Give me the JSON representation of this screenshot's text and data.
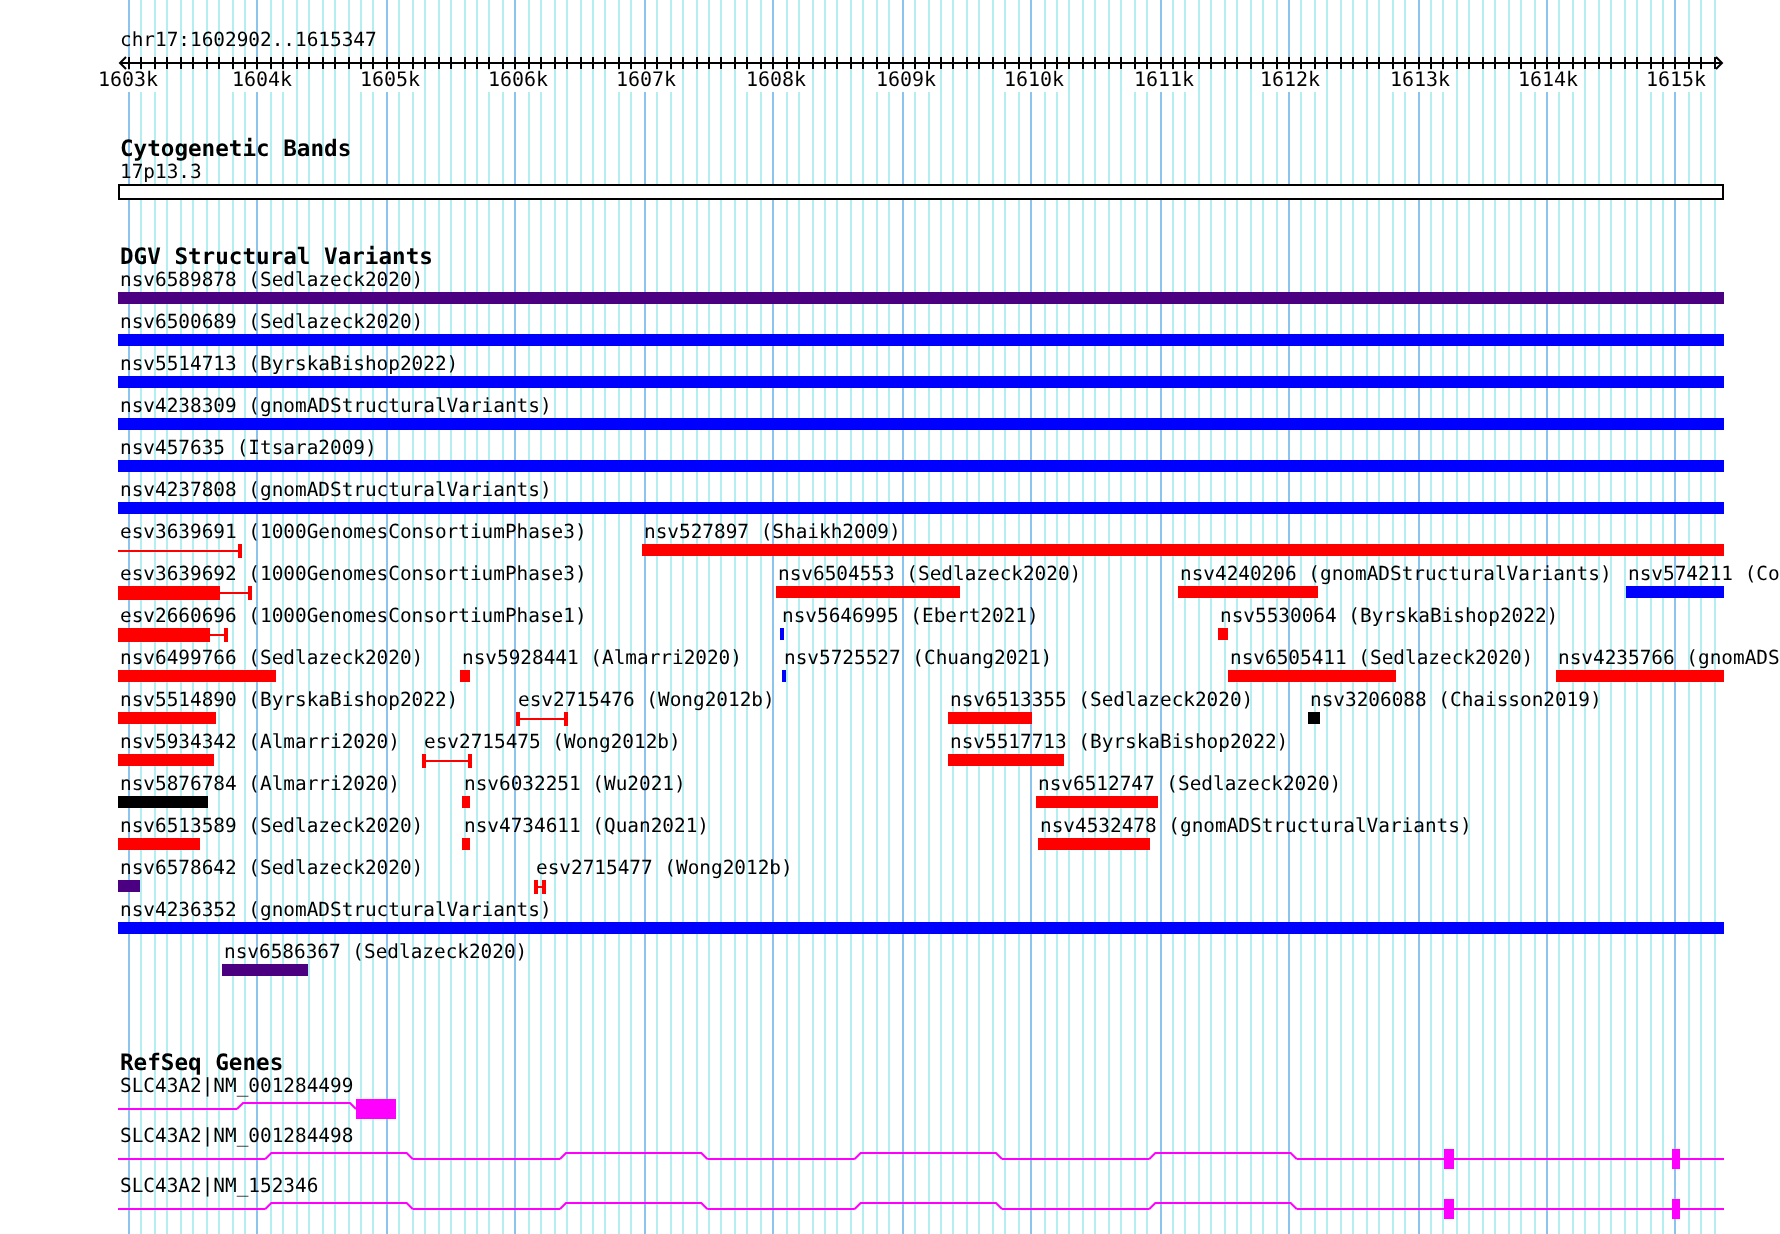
{
  "location": "chr17:1602902..1615347",
  "ruler": {
    "ticks": [
      "1603k",
      "1604k",
      "1605k",
      "1606k",
      "1607k",
      "1608k",
      "1609k",
      "1610k",
      "1611k",
      "1612k",
      "1613k",
      "1614k",
      "1615k"
    ]
  },
  "tracks": [
    {
      "kind": "bands",
      "title": "Cytogenetic Bands",
      "bands": [
        {
          "label": "17p13.3"
        }
      ]
    },
    {
      "kind": "variants",
      "title": "DGV Structural Variants",
      "rows": [
        {
          "features": [
            {
              "label": "nsv6589878 (Sedlazeck2020)",
              "kind": "bar",
              "color": "#4b0082"
            }
          ]
        },
        {
          "features": [
            {
              "label": "nsv6500689 (Sedlazeck2020)",
              "kind": "bar",
              "color": "#0000ff"
            }
          ]
        },
        {
          "features": [
            {
              "label": "nsv5514713 (ByrskaBishop2022)",
              "kind": "bar",
              "color": "#0000ff"
            }
          ]
        },
        {
          "features": [
            {
              "label": "nsv4238309 (gnomADStructuralVariants)",
              "kind": "bar",
              "color": "#0000ff"
            }
          ]
        },
        {
          "features": [
            {
              "label": "nsv457635 (Itsara2009)",
              "kind": "bar",
              "color": "#0000ff"
            }
          ]
        },
        {
          "features": [
            {
              "label": "nsv4237808 (gnomADStructuralVariants)",
              "kind": "bar",
              "color": "#0000ff"
            }
          ]
        },
        {
          "features": [
            {
              "label": "esv3639691 (1000GenomesConsortiumPhase3)",
              "kind": "interval",
              "color": "#ff0000"
            },
            {
              "label": "nsv527897 (Shaikh2009)",
              "kind": "bar",
              "color": "#ff0000"
            }
          ]
        },
        {
          "features": [
            {
              "label": "esv3639692 (1000GenomesConsortiumPhase3)",
              "kind": "interval",
              "color": "#ff0000"
            },
            {
              "label": "nsv6504553 (Sedlazeck2020)",
              "kind": "bar",
              "color": "#ff0000"
            },
            {
              "label": "nsv4240206 (gnomADStructuralVariants)",
              "kind": "bar",
              "color": "#ff0000"
            },
            {
              "label": "nsv574211 (Co",
              "kind": "bar",
              "color": "#0000ff"
            }
          ]
        },
        {
          "features": [
            {
              "label": "esv2660696 (1000GenomesConsortiumPhase1)",
              "kind": "interval",
              "color": "#ff0000"
            },
            {
              "label": "nsv5646995 (Ebert2021)",
              "kind": "bar",
              "color": "#0000ff"
            },
            {
              "label": "nsv5530064 (ByrskaBishop2022)",
              "kind": "bar",
              "color": "#ff0000"
            }
          ]
        },
        {
          "features": [
            {
              "label": "nsv6499766 (Sedlazeck2020)",
              "kind": "bar",
              "color": "#ff0000"
            },
            {
              "label": "nsv5928441 (Almarri2020)",
              "kind": "bar",
              "color": "#ff0000"
            },
            {
              "label": "nsv5725527 (Chuang2021)",
              "kind": "bar",
              "color": "#0000ff"
            },
            {
              "label": "nsv6505411 (Sedlazeck2020)",
              "kind": "bar",
              "color": "#ff0000"
            },
            {
              "label": "nsv4235766 (gnomADS",
              "kind": "bar",
              "color": "#ff0000"
            }
          ]
        },
        {
          "features": [
            {
              "label": "nsv5514890 (ByrskaBishop2022)",
              "kind": "bar",
              "color": "#ff0000"
            },
            {
              "label": "esv2715476 (Wong2012b)",
              "kind": "interval",
              "color": "#ff0000"
            },
            {
              "label": "nsv6513355 (Sedlazeck2020)",
              "kind": "bar",
              "color": "#ff0000"
            },
            {
              "label": "nsv3206088 (Chaisson2019)",
              "kind": "bar",
              "color": "#000000"
            }
          ]
        },
        {
          "features": [
            {
              "label": "nsv5934342 (Almarri2020)",
              "kind": "bar",
              "color": "#ff0000"
            },
            {
              "label": "esv2715475 (Wong2012b)",
              "kind": "interval",
              "color": "#ff0000"
            },
            {
              "label": "nsv5517713 (ByrskaBishop2022)",
              "kind": "bar",
              "color": "#ff0000"
            }
          ]
        },
        {
          "features": [
            {
              "label": "nsv5876784 (Almarri2020)",
              "kind": "bar",
              "color": "#000000"
            },
            {
              "label": "nsv6032251 (Wu2021)",
              "kind": "bar",
              "color": "#ff0000"
            },
            {
              "label": "nsv6512747 (Sedlazeck2020)",
              "kind": "bar",
              "color": "#ff0000"
            }
          ]
        },
        {
          "features": [
            {
              "label": "nsv6513589 (Sedlazeck2020)",
              "kind": "bar",
              "color": "#ff0000"
            },
            {
              "label": "nsv4734611 (Quan2021)",
              "kind": "bar",
              "color": "#ff0000"
            },
            {
              "label": "nsv4532478 (gnomADStructuralVariants)",
              "kind": "bar",
              "color": "#ff0000"
            }
          ]
        },
        {
          "features": [
            {
              "label": "nsv6578642 (Sedlazeck2020)",
              "kind": "bar",
              "color": "#4b0082"
            },
            {
              "label": "esv2715477 (Wong2012b)",
              "kind": "interval",
              "color": "#ff0000"
            }
          ]
        },
        {
          "features": [
            {
              "label": "nsv4236352 (gnomADStructuralVariants)",
              "kind": "bar",
              "color": "#0000ff"
            }
          ]
        },
        {
          "features": [
            {
              "label": "nsv6586367 (Sedlazeck2020)",
              "kind": "bar",
              "color": "#4b0082"
            }
          ]
        }
      ]
    },
    {
      "kind": "genes",
      "title": "RefSeq Genes",
      "transcripts": [
        {
          "label": "SLC43A2|NM_001284499"
        },
        {
          "label": "SLC43A2|NM_001284498"
        },
        {
          "label": "SLC43A2|NM_152346"
        }
      ]
    }
  ]
}
